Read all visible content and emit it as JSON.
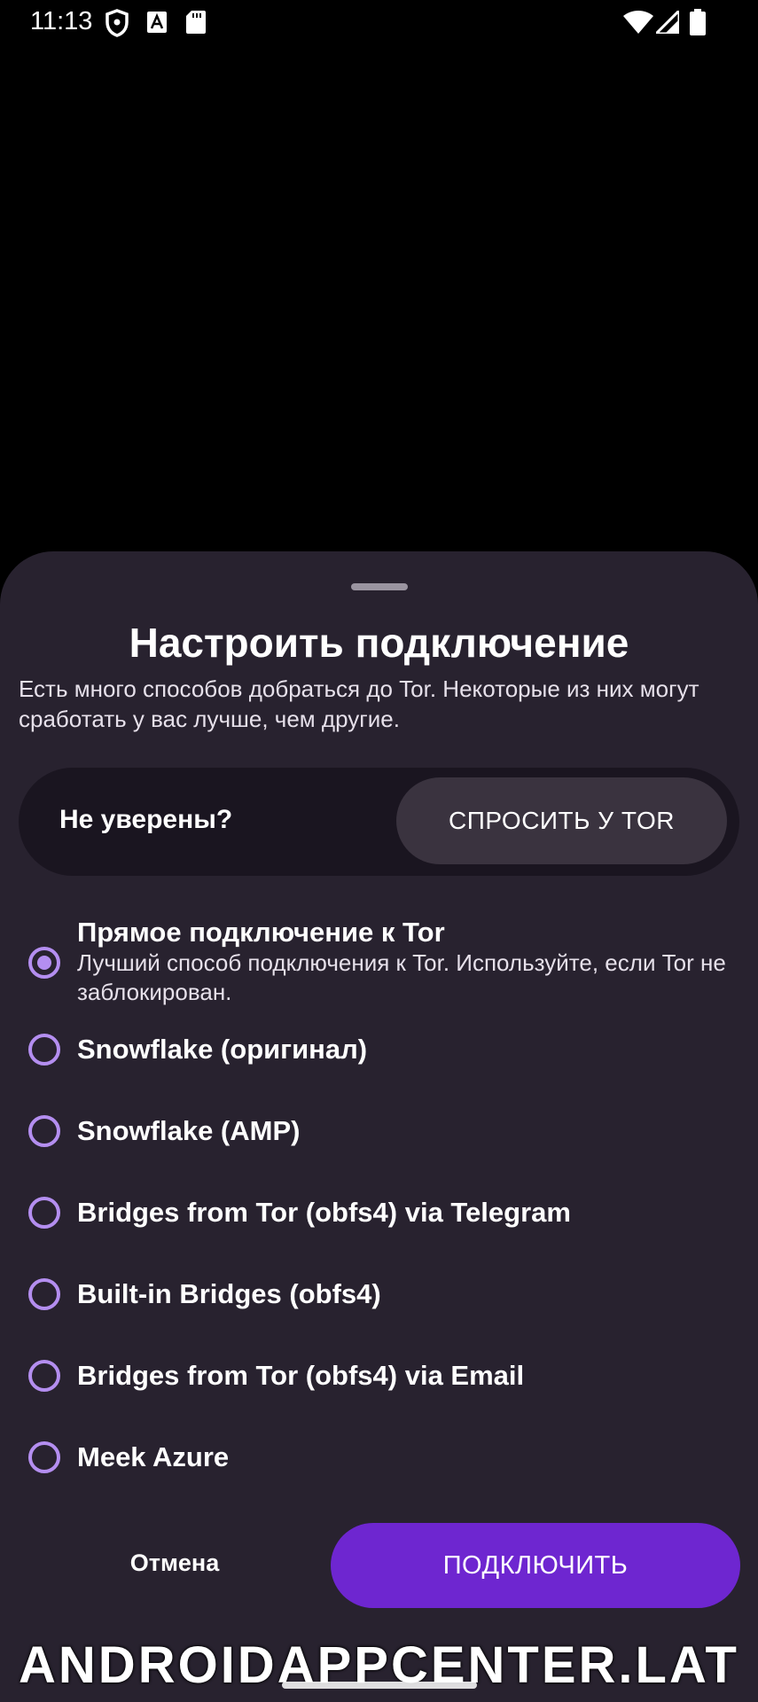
{
  "status_bar": {
    "time": "11:13",
    "icons": [
      "shield-icon",
      "font-a-icon",
      "sd-card-icon",
      "wifi-icon",
      "signal-icon",
      "battery-icon"
    ]
  },
  "sheet": {
    "title": "Настроить подключение",
    "description": "Есть много способов добраться до Tor. Некоторые из них могут сработать у вас лучше, чем другие.",
    "ask": {
      "label": "Не уверены?",
      "button": "СПРОСИТЬ У TOR"
    },
    "options": [
      {
        "title": "Прямое подключение к Tor",
        "description": "Лучший способ подключения к Tor. Используйте, если Tor не заблокирован.",
        "selected": true
      },
      {
        "title": "Snowflake (оригинал)",
        "selected": false
      },
      {
        "title": "Snowflake (AMP)",
        "selected": false
      },
      {
        "title": "Bridges from Tor (obfs4) via Telegram",
        "selected": false
      },
      {
        "title": "Built-in Bridges (obfs4)",
        "selected": false
      },
      {
        "title": "Bridges from Tor (obfs4) via Email",
        "selected": false
      },
      {
        "title": "Meek Azure",
        "selected": false
      }
    ],
    "cancel_label": "Отмена",
    "connect_label": "ПОДКЛЮЧИТЬ"
  },
  "watermark": "ANDROIDAPPCENTER.LAT",
  "colors": {
    "sheet_bg": "#28222f",
    "accent": "#6e26d0",
    "radio": "#b48ef0"
  }
}
